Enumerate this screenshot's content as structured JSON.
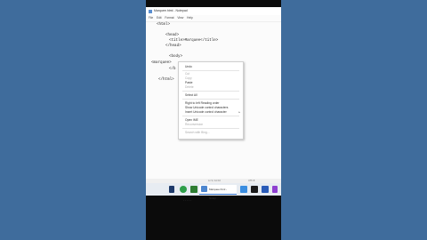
{
  "window": {
    "title": "Marquee.html - Notepad",
    "menu": [
      "File",
      "Edit",
      "Format",
      "View",
      "Help"
    ]
  },
  "code_lines": [
    "<html>",
    "<head>",
    "<title>Marquee</title>",
    "</head>",
    "<body>",
    "<marquee>",
    "</b",
    "</html>"
  ],
  "context_menu": {
    "items": [
      {
        "label": "Undo",
        "disabled": false
      },
      {
        "label": "Cut",
        "disabled": true
      },
      {
        "label": "Copy",
        "disabled": true
      },
      {
        "label": "Paste",
        "disabled": false
      },
      {
        "label": "Delete",
        "disabled": true
      },
      {
        "label": "Select All",
        "disabled": false
      },
      {
        "label": "Right to left Reading order",
        "disabled": false
      },
      {
        "label": "Show Unicode control characters",
        "disabled": false
      },
      {
        "label": "Insert Unicode control character",
        "disabled": false,
        "submenu": true
      },
      {
        "label": "Open IME",
        "disabled": false
      },
      {
        "label": "Reconversion",
        "disabled": true
      },
      {
        "label": "Search with Bing...",
        "disabled": true
      }
    ]
  },
  "statusbar": {
    "position": "Ln 9, Col 10",
    "encoding": "UTF-8"
  },
  "taskbar": {
    "active_window_label": "Marquee.html - Notep..."
  },
  "below_text": "·  ·  ·  ·  ·"
}
